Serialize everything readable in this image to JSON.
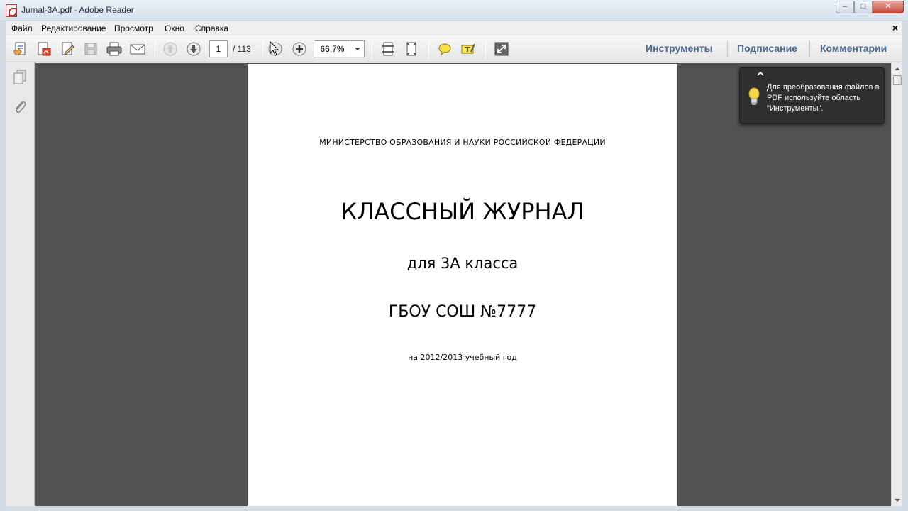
{
  "window": {
    "title": "Jurnal-3A.pdf - Adobe Reader",
    "buttons": {
      "minimize": "–",
      "maximize": "□",
      "close": "✕"
    }
  },
  "menu": {
    "items": [
      "Файл",
      "Редактирование",
      "Просмотр",
      "Окно",
      "Справка"
    ],
    "close": "×"
  },
  "toolbar": {
    "page_current": "1",
    "page_total": "/ 113",
    "zoom": "66,7%",
    "panels": [
      "Инструменты",
      "Подписание",
      "Комментарии"
    ]
  },
  "document": {
    "ministry": "МИНИСТЕРСТВО ОБРАЗОВАНИЯ И НАУКИ РОССИЙСКОЙ ФЕДЕРАЦИИ",
    "title": "КЛАССНЫЙ ЖУРНАЛ",
    "class_line": "для 3А класса",
    "school": "ГБОУ СОШ №7777",
    "year": "на 2012/2013 учебный год"
  },
  "tooltip": {
    "text": "Для преобразования файлов в PDF используйте область \"Инструменты\"."
  },
  "colors": {
    "doc_background": "#525252",
    "panel_link": "#4a6b8c",
    "tooltip_bg": "#2f2f2f"
  }
}
